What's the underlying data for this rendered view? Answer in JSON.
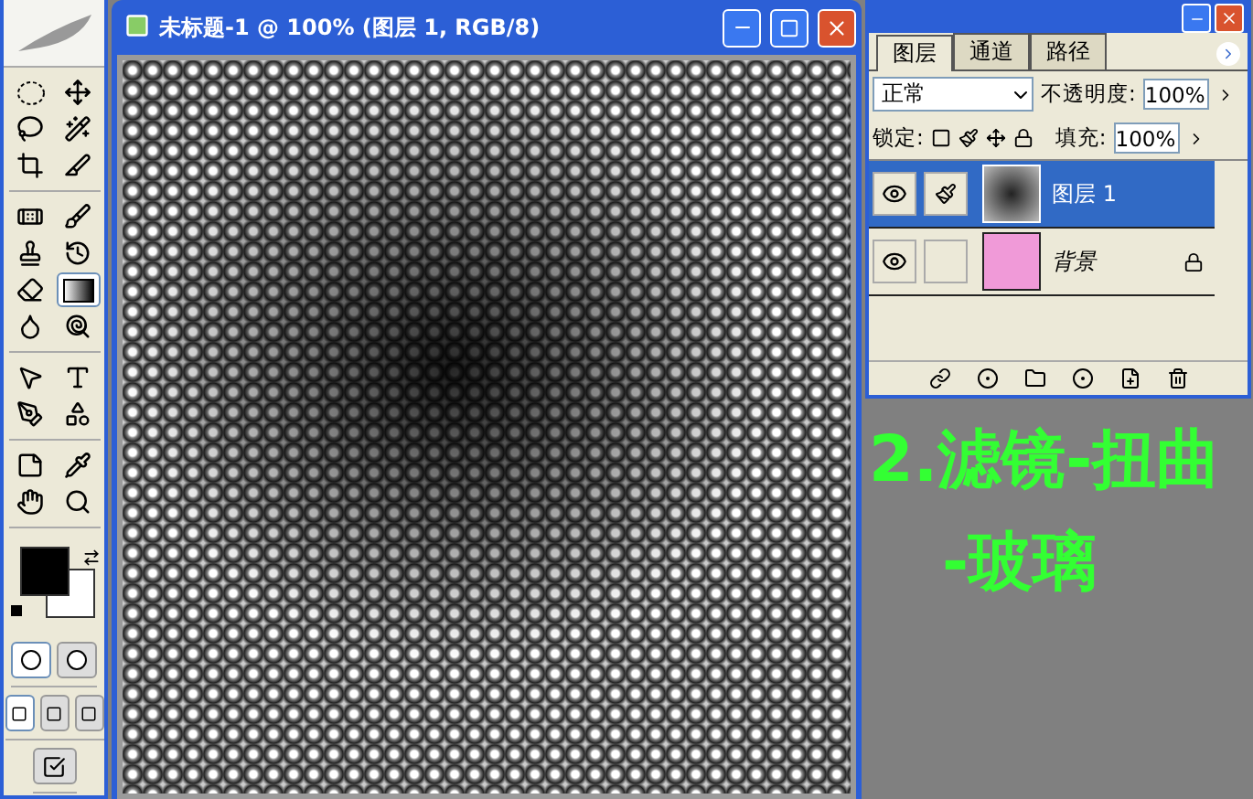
{
  "toolbox": {
    "tools": [
      {
        "selected": false
      },
      {
        "selected": false
      },
      {
        "selected": false
      },
      {
        "selected": false
      },
      {
        "selected": false
      },
      {
        "selected": false
      },
      {
        "selected": false
      },
      {
        "selected": false
      },
      {
        "selected": false
      },
      {
        "selected": false
      },
      {
        "selected": false
      },
      {
        "selected": true
      },
      {
        "selected": false
      },
      {
        "selected": false
      },
      {
        "selected": false
      },
      {
        "selected": false
      },
      {
        "selected": false
      },
      {
        "selected": false
      },
      {
        "selected": false
      },
      {
        "selected": false
      },
      {
        "selected": false
      },
      {
        "selected": false
      }
    ],
    "mask_modes": [
      {
        "selected": true
      },
      {
        "selected": false
      }
    ],
    "screen_modes": [
      {
        "selected": true
      },
      {
        "selected": false
      },
      {
        "selected": false
      }
    ]
  },
  "document": {
    "title": "未标题-1 @ 100% (图层 1, RGB/8)"
  },
  "layers_panel": {
    "tabs": [
      {
        "label": "图层",
        "selected": true
      },
      {
        "label": "通道",
        "selected": false
      },
      {
        "label": "路径",
        "selected": false
      }
    ],
    "blend_mode": "正常",
    "opacity_label": "不透明度:",
    "opacity": "100%",
    "lock_label": "锁定:",
    "fill_label": "填充:",
    "fill": "100%",
    "layers": [
      {
        "name": "图层 1",
        "selected": true,
        "visible": true,
        "locked": false,
        "kind": "pattern"
      },
      {
        "name": "背景",
        "selected": false,
        "visible": true,
        "locked": true,
        "kind": "fill",
        "color": "#f09ad8"
      }
    ]
  },
  "caption": {
    "lines": [
      "2.滤镜-扭曲",
      "-玻璃"
    ]
  }
}
